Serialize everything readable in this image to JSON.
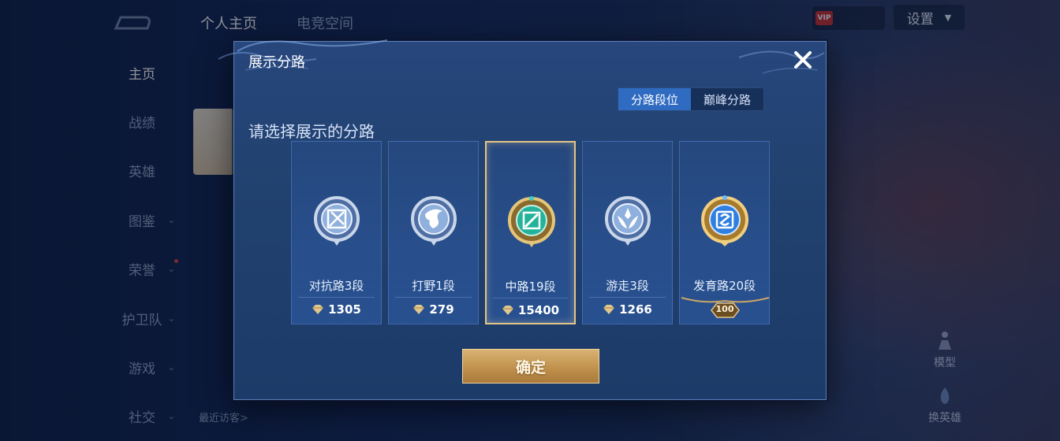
{
  "background": {
    "nav": [
      {
        "label": "主页",
        "active": true,
        "chevron": false
      },
      {
        "label": "战绩",
        "active": false,
        "chevron": false
      },
      {
        "label": "英雄",
        "active": false,
        "chevron": false
      },
      {
        "label": "图鉴",
        "active": false,
        "chevron": true
      },
      {
        "label": "荣誉",
        "active": false,
        "chevron": true
      },
      {
        "label": "护卫队",
        "active": false,
        "chevron": true
      },
      {
        "label": "游戏",
        "active": false,
        "chevron": true
      },
      {
        "label": "社交",
        "active": false,
        "chevron": true
      }
    ],
    "tabs": [
      "个人主页",
      "电竞空间"
    ],
    "settings_label": "设置",
    "vip_label": "VIP",
    "model_label": "模型",
    "change_hero_label": "换英雄",
    "visitors_label": "最近访客>"
  },
  "modal": {
    "title": "展示分路",
    "segments": [
      {
        "label": "分路段位",
        "active": true
      },
      {
        "label": "巅峰分路",
        "active": false
      }
    ],
    "subtitle": "请选择展示的分路",
    "lanes": [
      {
        "name": "对抗路3段",
        "score": "1305",
        "selected": false,
        "icon": "clash-lane-emblem-icon",
        "tier": "silver"
      },
      {
        "name": "打野1段",
        "score": "279",
        "selected": false,
        "icon": "jungle-emblem-icon",
        "tier": "silver"
      },
      {
        "name": "中路19段",
        "score": "15400",
        "selected": true,
        "icon": "mid-lane-emblem-icon",
        "tier": "jade"
      },
      {
        "name": "游走3段",
        "score": "1266",
        "selected": false,
        "icon": "roam-emblem-icon",
        "tier": "silver"
      },
      {
        "name": "发育路20段",
        "score": "100",
        "selected": false,
        "icon": "farm-lane-emblem-icon",
        "tier": "gold"
      }
    ],
    "confirm_label": "确定"
  },
  "colors": {
    "accent_blue": "#2f6bc1",
    "gold": "#c49550",
    "selected_border": "#e3c48a"
  }
}
